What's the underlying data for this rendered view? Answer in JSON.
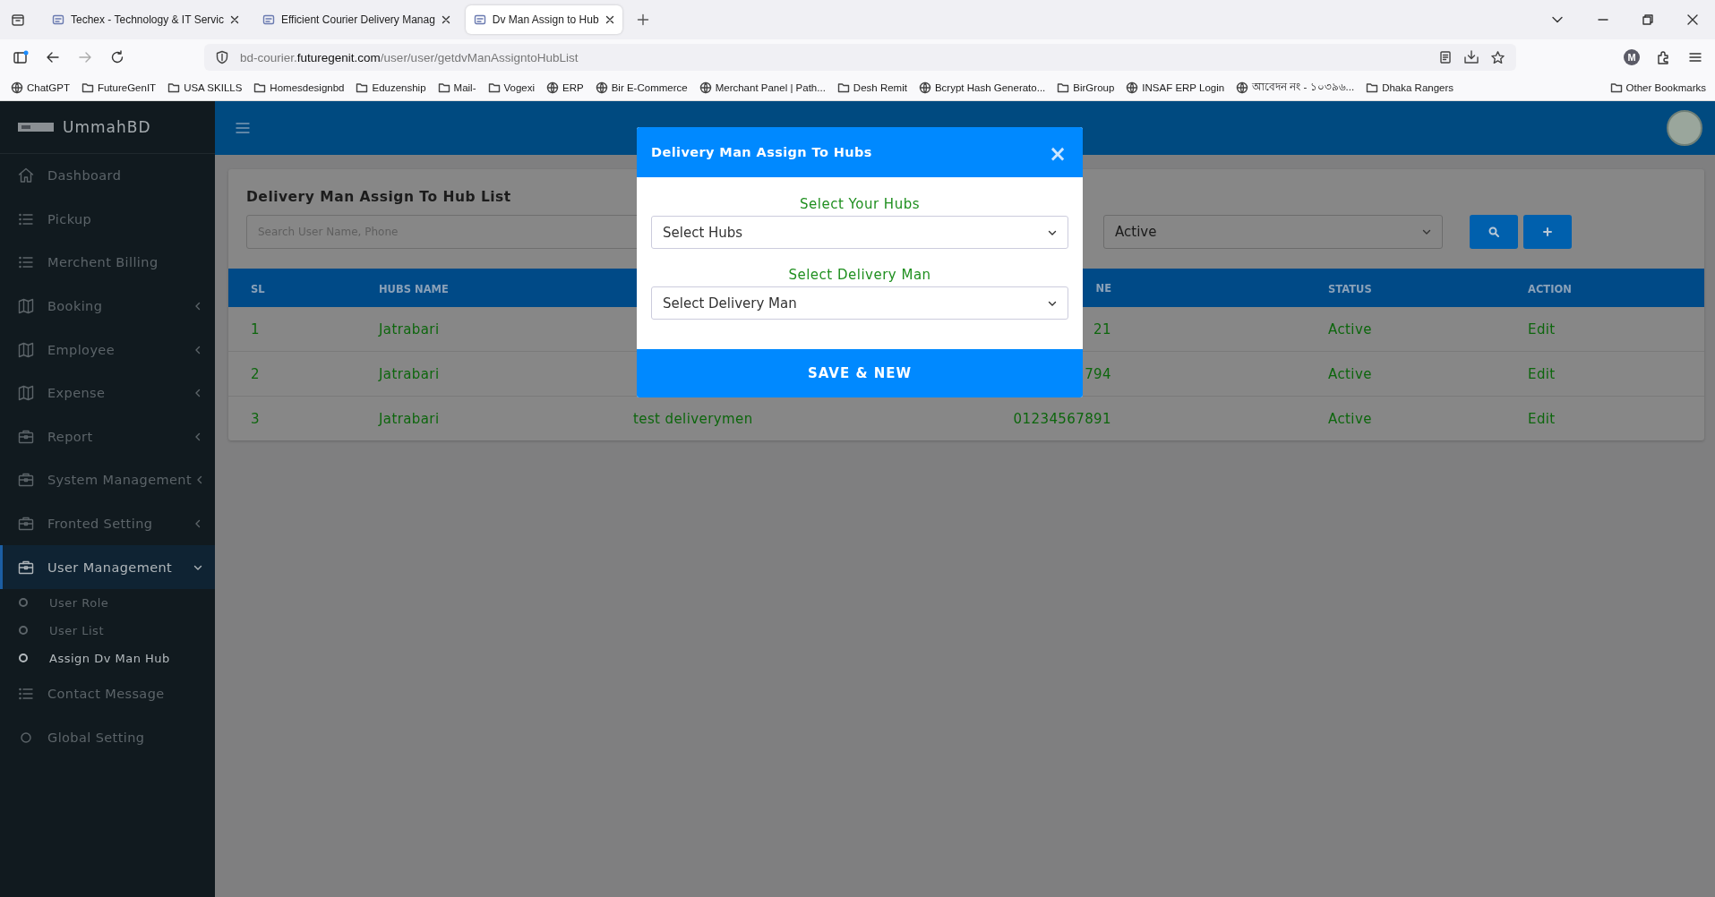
{
  "browser": {
    "tabs": [
      {
        "title": "Techex - Technology & IT Servic",
        "selected": false
      },
      {
        "title": "Efficient Courier Delivery Manag",
        "selected": false
      },
      {
        "title": "Dv Man Assign to Hub",
        "selected": true
      }
    ],
    "url": "bd-courier.**futuregenit.com**/user/user/getdvManAssigntoHubList",
    "profile_initial": "M",
    "bookmarks": [
      {
        "label": "ChatGPT",
        "kind": "site"
      },
      {
        "label": "FutureGenIT",
        "kind": "folder"
      },
      {
        "label": "USA SKILLS",
        "kind": "folder"
      },
      {
        "label": "Homesdesignbd",
        "kind": "folder"
      },
      {
        "label": "Eduzenship",
        "kind": "folder"
      },
      {
        "label": "Mail-",
        "kind": "folder"
      },
      {
        "label": "Vogexi",
        "kind": "folder"
      },
      {
        "label": "ERP",
        "kind": "site"
      },
      {
        "label": "Bir E-Commerce",
        "kind": "site"
      },
      {
        "label": "Merchant Panel | Path...",
        "kind": "site"
      },
      {
        "label": "Desh Remit",
        "kind": "folder"
      },
      {
        "label": "Bcrypt Hash Generato...",
        "kind": "site"
      },
      {
        "label": "BirGroup",
        "kind": "folder"
      },
      {
        "label": "INSAF ERP Login",
        "kind": "site"
      },
      {
        "label": "আবেদন নং - ১০৩৯৬...",
        "kind": "site"
      },
      {
        "label": "Dhaka Rangers",
        "kind": "folder"
      }
    ],
    "other_bookmarks": "Other Bookmarks"
  },
  "sidebar": {
    "brand": "UmmahBD",
    "items": [
      {
        "label": "Dashboard",
        "kind": "home",
        "selected": false
      },
      {
        "label": "Pickup",
        "kind": "list",
        "selected": false
      },
      {
        "label": "Merchent Billing",
        "kind": "list",
        "selected": false
      },
      {
        "label": "Booking",
        "kind": "map",
        "expanded": false,
        "selected": false
      },
      {
        "label": "Employee",
        "kind": "map",
        "expanded": false,
        "selected": false
      },
      {
        "label": "Expense",
        "kind": "map",
        "expanded": false,
        "selected": false
      },
      {
        "label": "Report",
        "kind": "briefcase",
        "expanded": false,
        "selected": false
      },
      {
        "label": "System Management",
        "kind": "briefcase",
        "expanded": false,
        "selected": false
      },
      {
        "label": "Fronted Setting",
        "kind": "briefcase",
        "expanded": false,
        "selected": false
      },
      {
        "label": "User Management",
        "kind": "briefcase",
        "expanded": true,
        "selected": true,
        "children": [
          {
            "label": "User Role",
            "selected": false
          },
          {
            "label": "User List",
            "selected": false
          },
          {
            "label": "Assign Dv Man Hub",
            "selected": true
          }
        ]
      },
      {
        "label": "Contact Message",
        "kind": "list",
        "selected": false
      },
      {
        "label": "Global Setting",
        "kind": "circle",
        "selected": false
      }
    ]
  },
  "page": {
    "title": "Delivery Man Assign To Hub List",
    "search": {
      "placeholder": "Search User Name, Phone"
    },
    "status_filter": {
      "value": "Active"
    },
    "table": {
      "columns": {
        "sl": "SL",
        "hubs_name": "HUBS NAME",
        "column_4": "NE",
        "status": "STATUS",
        "action": "ACTION"
      },
      "rows": [
        {
          "sl": "1",
          "hubs_name": "Jatrabari",
          "column_4": "21",
          "status": "Active",
          "action": "Edit"
        },
        {
          "sl": "2",
          "hubs_name": "Jatrabari",
          "column_4": "794",
          "status": "Active",
          "action": "Edit"
        },
        {
          "sl": "3",
          "hubs_name": "Jatrabari",
          "column_3": "test deliverymen",
          "column_4": "01234567891",
          "status": "Active",
          "action": "Edit"
        }
      ]
    }
  },
  "modal": {
    "title": "Delivery Man Assign To Hubs",
    "close": "×",
    "fields": [
      {
        "label": "Select Your Hubs",
        "value": "Select Hubs"
      },
      {
        "label": "Select Delivery Man",
        "value": "Select Delivery Man"
      }
    ],
    "submit": "SAVE & NEW"
  }
}
